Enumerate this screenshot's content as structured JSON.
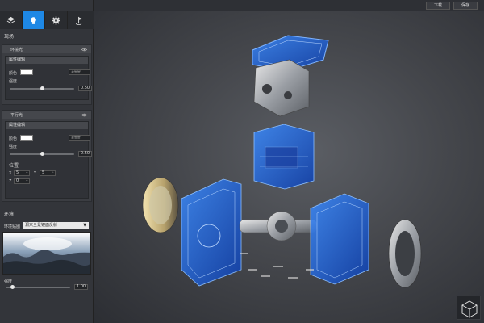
{
  "topbar": {
    "download_label": "下载",
    "save_label": "保存"
  },
  "toolbar": {
    "tabs": [
      {
        "name": "layers-icon",
        "active": false
      },
      {
        "name": "lightbulb-icon",
        "active": true
      },
      {
        "name": "gear-icon",
        "active": false
      },
      {
        "name": "flag-icon",
        "active": false
      }
    ]
  },
  "scene": {
    "title": "现场",
    "ambient": {
      "label": "环境光",
      "editor_title": "属性编辑",
      "color_label": "颜色",
      "color_hex": "#ffffff",
      "intensity_label": "强度",
      "intensity": "0.50",
      "intensity_fraction": 0.5
    },
    "directional": {
      "label": "平行光",
      "editor_title": "属性编辑",
      "color_label": "颜色",
      "color_hex": "#ffffff",
      "intensity_label": "强度",
      "intensity": "0.50",
      "intensity_fraction": 0.5,
      "position_label": "位置",
      "x_label": "X",
      "x": "5",
      "y_label": "Y",
      "y": "5",
      "z_label": "Z",
      "z": "0"
    }
  },
  "environment": {
    "title": "环境",
    "map_label": "环境贴图",
    "map_selected": "洞穴全景镜面反射",
    "intensity_label": "强度",
    "intensity": "1.00",
    "intensity_fraction": 0.1
  },
  "colors": {
    "accent": "#1e88e5",
    "panel": "#33353a",
    "wireframe": "#1f6fff"
  }
}
